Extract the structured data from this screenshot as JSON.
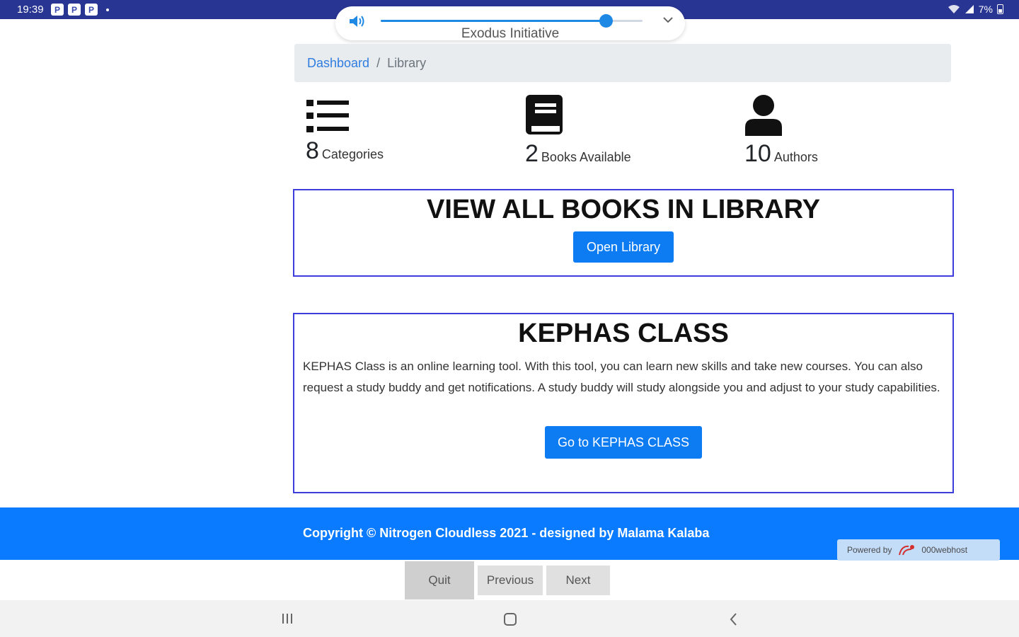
{
  "status_bar": {
    "time": "19:39",
    "app_badges": [
      "P",
      "P",
      "P"
    ],
    "battery_text": "7%"
  },
  "volume_panel": {
    "level_fraction": 0.86,
    "subtitle": "Exodus Initiative"
  },
  "breadcrumb": {
    "home_label": "Dashboard",
    "separator": "/",
    "current_label": "Library"
  },
  "stats": [
    {
      "icon": "list-icon",
      "value": "8",
      "label": "Categories"
    },
    {
      "icon": "book-icon",
      "value": "2",
      "label": "Books Available"
    },
    {
      "icon": "user-icon",
      "value": "10",
      "label": "Authors"
    }
  ],
  "library_card": {
    "title": "VIEW ALL BOOKS IN LIBRARY",
    "button_label": "Open Library"
  },
  "kephas_card": {
    "title": "KEPHAS CLASS",
    "description": "KEPHAS Class is an online learning tool. With this tool, you can learn new skills and take new courses. You can also request a study buddy and get notifications. A study buddy will study alongside you and adjust to your study capabilities.",
    "button_label": "Go to KEPHAS CLASS"
  },
  "footer": {
    "copyright": "Copyright © Nitrogen Cloudless 2021 - designed by Malama Kalaba",
    "powered_by": "Powered by",
    "host_name": "000webhost"
  },
  "nav_buttons": {
    "quit": "Quit",
    "previous": "Previous",
    "next": "Next"
  },
  "colors": {
    "status_bar": "#283593",
    "primary": "#0d7cf2",
    "card_border": "#3d3ddc",
    "footer": "#0a7bff"
  }
}
